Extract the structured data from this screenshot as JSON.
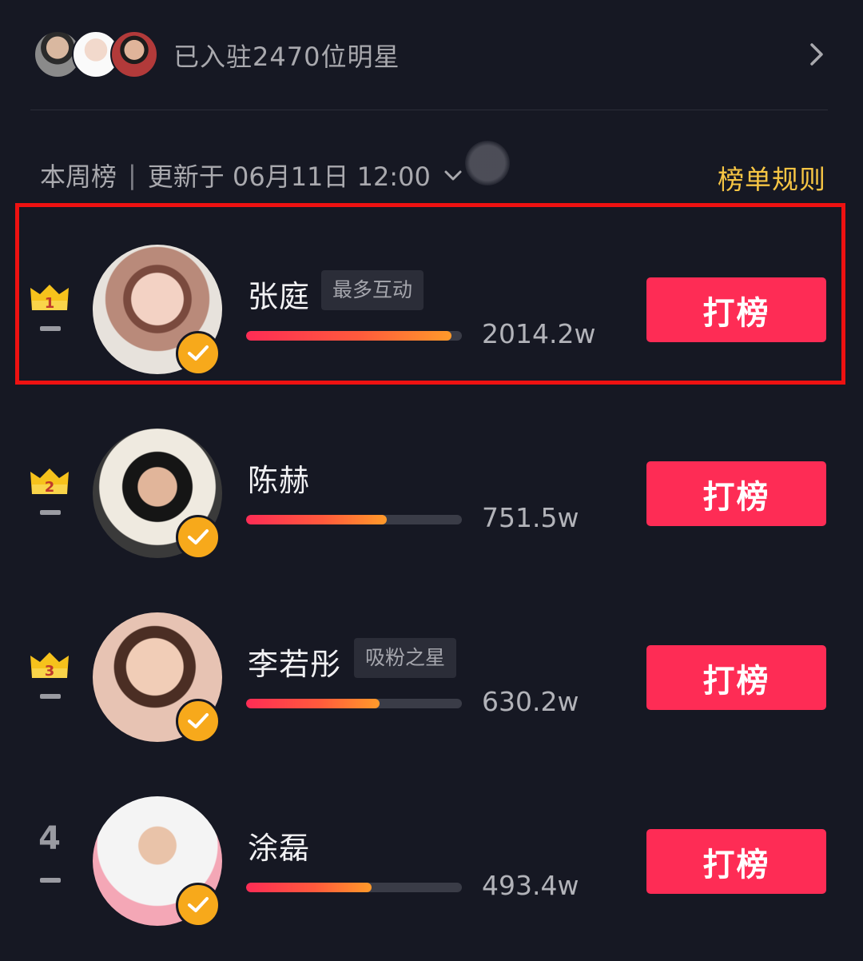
{
  "banner": {
    "text": "已入驻2470位明星"
  },
  "header": {
    "period": "本周榜",
    "separator": "|",
    "updated": "更新于 06月11日 12:00",
    "rules_label": "榜单规则"
  },
  "colors": {
    "background": "#161823",
    "accent_red": "#fe2c55",
    "gold": "#f6c544",
    "verify_orange": "#f7a91b",
    "highlight_border": "#ee1111"
  },
  "list": [
    {
      "rank": "1",
      "rank_icon": "crown-icon",
      "name": "张庭",
      "tag": "最多互动",
      "heat": "2014.2w",
      "bar_fraction": 0.95,
      "button": "打榜",
      "highlighted": true
    },
    {
      "rank": "2",
      "rank_icon": "crown-icon",
      "name": "陈赫",
      "tag": "",
      "heat": "751.5w",
      "bar_fraction": 0.65,
      "button": "打榜",
      "highlighted": false
    },
    {
      "rank": "3",
      "rank_icon": "crown-icon",
      "name": "李若彤",
      "tag": "吸粉之星",
      "heat": "630.2w",
      "bar_fraction": 0.62,
      "button": "打榜",
      "highlighted": false
    },
    {
      "rank": "4",
      "rank_icon": "",
      "name": "涂磊",
      "tag": "",
      "heat": "493.4w",
      "bar_fraction": 0.58,
      "button": "打榜",
      "highlighted": false
    }
  ]
}
